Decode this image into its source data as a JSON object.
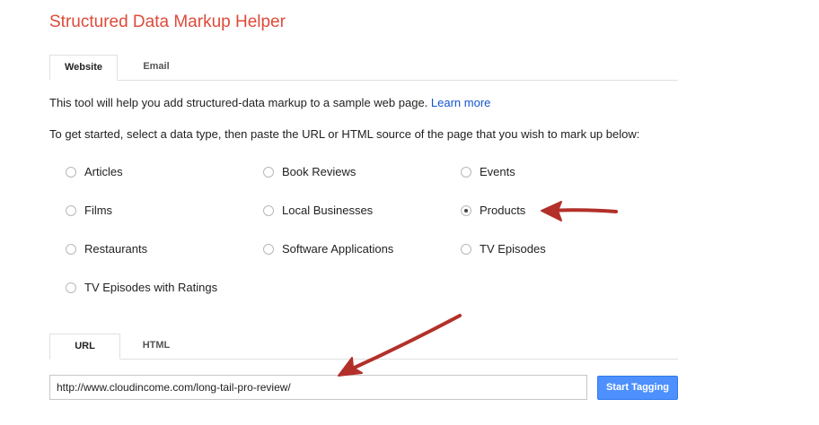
{
  "header": {
    "title": "Structured Data Markup Helper"
  },
  "top_tabs": [
    {
      "label": "Website",
      "active": true
    },
    {
      "label": "Email",
      "active": false
    }
  ],
  "intro": {
    "text": "This tool will help you add structured-data markup to a sample web page.",
    "link": "Learn more"
  },
  "instructions": "To get started, select a data type, then paste the URL or HTML source of the page that you wish to mark up below:",
  "data_types": [
    {
      "label": "Articles",
      "selected": false
    },
    {
      "label": "Book Reviews",
      "selected": false
    },
    {
      "label": "Events",
      "selected": false
    },
    {
      "label": "Films",
      "selected": false
    },
    {
      "label": "Local Businesses",
      "selected": false
    },
    {
      "label": "Products",
      "selected": true
    },
    {
      "label": "Restaurants",
      "selected": false
    },
    {
      "label": "Software Applications",
      "selected": false
    },
    {
      "label": "TV Episodes",
      "selected": false
    },
    {
      "label": "TV Episodes with Ratings",
      "selected": false
    }
  ],
  "source_tabs": [
    {
      "label": "URL",
      "active": true
    },
    {
      "label": "HTML",
      "active": false
    }
  ],
  "url_field": {
    "value": "http://www.cloudincome.com/long-tail-pro-review/"
  },
  "start_button": {
    "label": "Start Tagging"
  },
  "colors": {
    "title": "#dd4b39",
    "link": "#1155cc",
    "button": "#4d90fe",
    "annotation_arrow": "#b3302a"
  }
}
